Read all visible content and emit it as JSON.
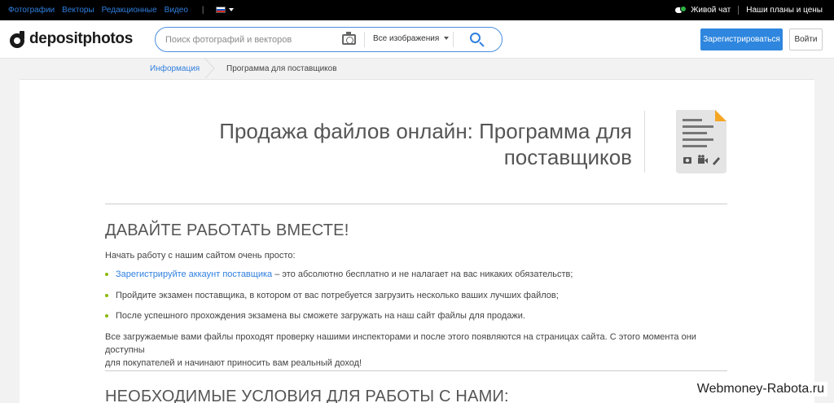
{
  "topbar": {
    "nav": [
      "Фотографии",
      "Векторы",
      "Редакционные",
      "Видео"
    ],
    "live_chat": "Живой чат",
    "plans": "Наши планы и цены"
  },
  "header": {
    "logo": "depositphotos",
    "search_placeholder": "Поиск фотографий и векторов",
    "search_filter": "Все изображения",
    "register": "Зарегистрироваться",
    "login": "Войти"
  },
  "breadcrumb": {
    "first": "Информация",
    "current": "Программа для поставщиков"
  },
  "main": {
    "title_line1": "Продажа файлов онлайн: Программа для",
    "title_line2": "поставщиков",
    "section1_title": "ДАВАЙТЕ РАБОТАТЬ ВМЕСТЕ!",
    "intro": "Начать работу с нашим сайтом очень просто:",
    "bullet1_link": "Зарегистрируйте аккаунт поставщика",
    "bullet1_rest": " – это абсолютно бесплатно и не налагает на вас никаких обязательств;",
    "bullet2": "Пройдите экзамен поставщика, в котором от вас потребуется загрузить несколько ваших лучших файлов;",
    "bullet3": "После успешного прохождения экзамена вы сможете загружать на наш сайт файлы для продажи.",
    "para_line1": "Все загружаемые вами файлы проходят проверку нашими инспекторами и после этого появляются на страницах сайта. С этого момента они доступны",
    "para_line2": "для покупателей и начинают приносить вам реальный доход!",
    "section2_title": "НЕОБХОДИМЫЕ УСЛОВИЯ ДЛЯ РАБОТЫ С НАМИ:"
  },
  "watermark": "Webmoney-Rabota.ru"
}
